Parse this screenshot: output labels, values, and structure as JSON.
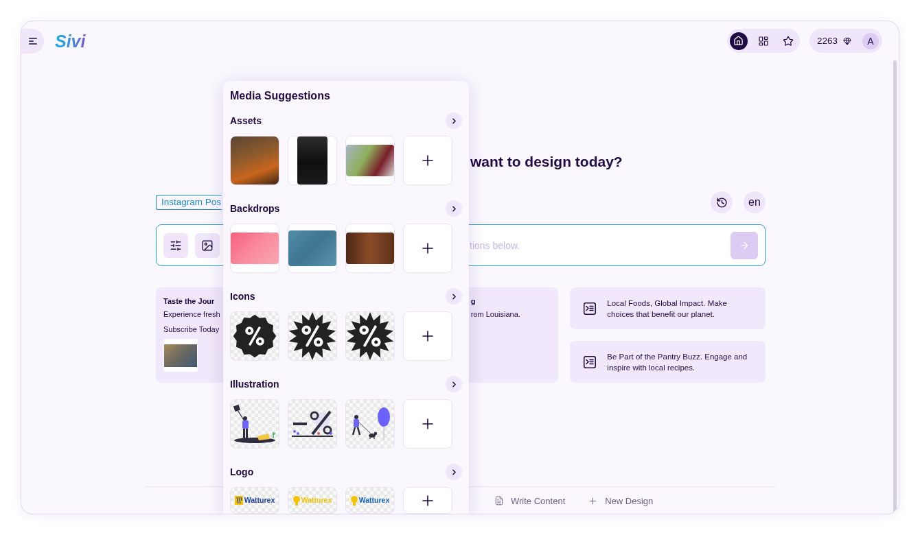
{
  "header": {
    "logo": "Sivi",
    "nav": [
      {
        "kind": "home",
        "selected": true
      },
      {
        "kind": "grid",
        "selected": false
      },
      {
        "kind": "star",
        "selected": false
      }
    ],
    "credits": "2263",
    "avatar": "A"
  },
  "heading": "want to design today?",
  "toolbar": {
    "format": "Instagram Pos",
    "language": "en"
  },
  "prompt": {
    "placeholder": "tions below.",
    "send_disabled": true
  },
  "cards": [
    {
      "kind": "idea",
      "title": "Taste the Jour",
      "lines": [
        "Experience fresh",
        "Subscribe Today"
      ],
      "thumbnail": true
    },
    {
      "kind": "idea",
      "title": "g",
      "lines": [
        "rom Louisiana."
      ],
      "thumbnail": false
    },
    {
      "kind": "suggestion",
      "text": "Local Foods, Global Impact. Make choices that benefit our planet."
    },
    {
      "kind": "suggestion",
      "text": "Be Part of the Pantry Buzz. Engage and inspire with local recipes."
    }
  ],
  "footer_actions": [
    {
      "kind": "write",
      "label": "Write Content"
    },
    {
      "kind": "new",
      "label": "New Design"
    }
  ],
  "media_panel": {
    "title": "Media Suggestions",
    "sections": [
      {
        "title": "Assets",
        "tiles": [
          {
            "kind": "photo"
          },
          {
            "kind": "photo"
          },
          {
            "kind": "photo"
          },
          {
            "kind": "add"
          }
        ]
      },
      {
        "title": "Backdrops",
        "tiles": [
          {
            "kind": "backdrop"
          },
          {
            "kind": "backdrop"
          },
          {
            "kind": "backdrop"
          },
          {
            "kind": "add"
          }
        ]
      },
      {
        "title": "Icons",
        "tiles": [
          {
            "kind": "icon"
          },
          {
            "kind": "icon"
          },
          {
            "kind": "icon"
          },
          {
            "kind": "add"
          }
        ]
      },
      {
        "title": "Illustration",
        "tiles": [
          {
            "kind": "illustration"
          },
          {
            "kind": "illustration"
          },
          {
            "kind": "illustration"
          },
          {
            "kind": "add"
          }
        ]
      },
      {
        "title": "Logo",
        "tiles": [
          {
            "kind": "logo",
            "text": "Watturex",
            "color": "#1b3fb0"
          },
          {
            "kind": "logo",
            "text": "Watturex",
            "color": "#f2c400"
          },
          {
            "kind": "logo",
            "text": "Watturex",
            "color": "#1565c8"
          },
          {
            "kind": "add"
          }
        ]
      }
    ]
  }
}
